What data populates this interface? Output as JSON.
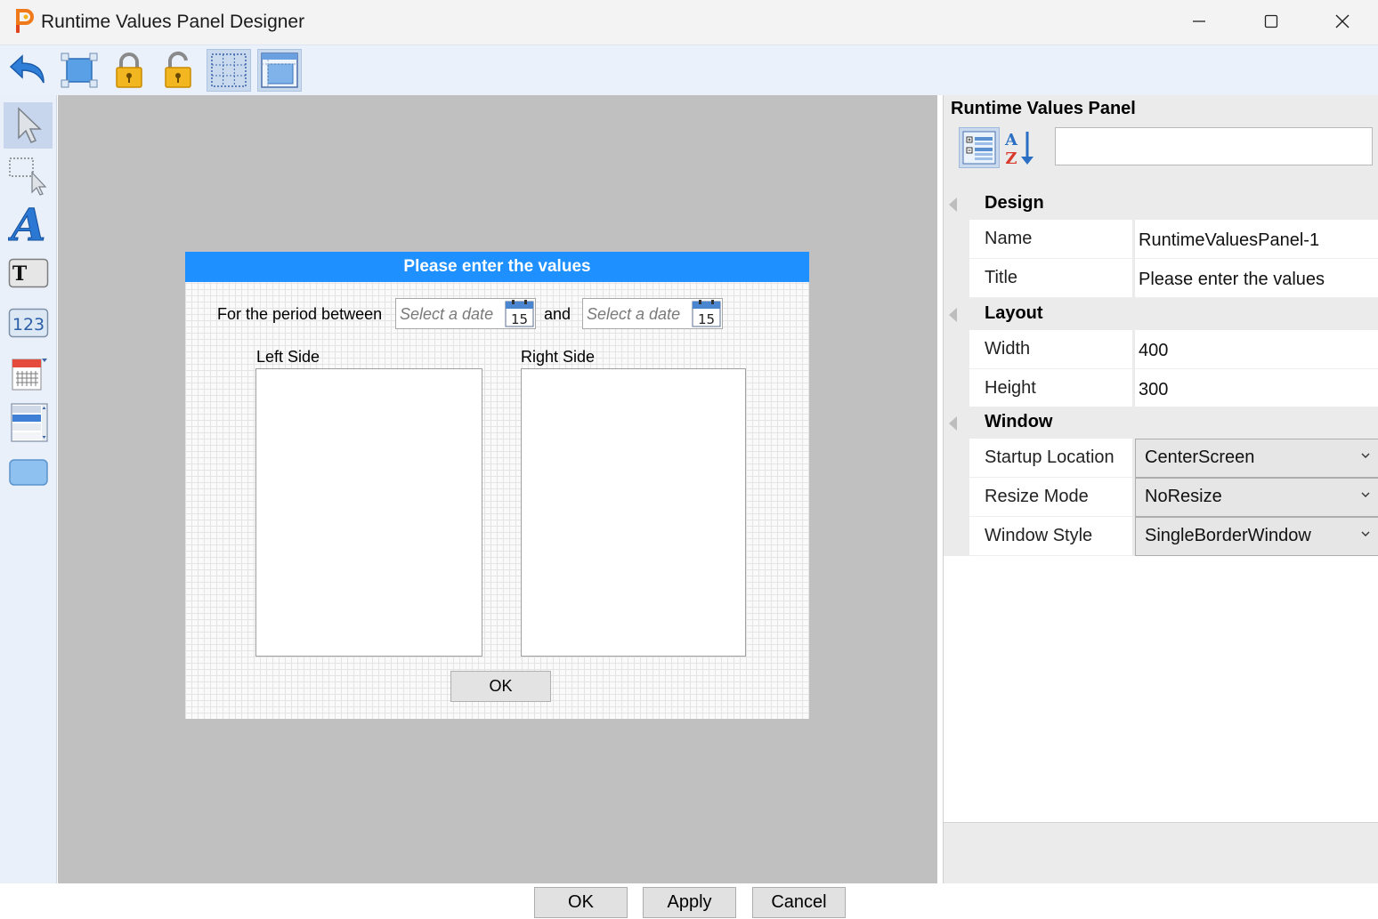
{
  "window": {
    "title": "Runtime Values Panel Designer",
    "icons": {
      "logo": "app-logo-icon",
      "minimize": "minimize-icon",
      "maximize": "maximize-icon",
      "close": "close-icon"
    }
  },
  "toolbar": {
    "items": [
      {
        "name": "undo-button",
        "icon": "undo-arrow-icon"
      },
      {
        "name": "select-all-button",
        "icon": "selection-frame-icon"
      },
      {
        "name": "lock-button",
        "icon": "lock-icon"
      },
      {
        "name": "unlock-button",
        "icon": "unlock-icon"
      },
      {
        "name": "show-grid-button",
        "icon": "grid-icon",
        "active": true
      },
      {
        "name": "snap-to-grid-button",
        "icon": "panel-grid-icon",
        "active": true
      }
    ]
  },
  "toolbox": {
    "items": [
      {
        "name": "pointer-tool",
        "icon": "cursor-arrow-icon",
        "active": true
      },
      {
        "name": "marquee-select-tool",
        "icon": "marquee-select-icon"
      },
      {
        "name": "label-tool",
        "icon": "label-a-icon"
      },
      {
        "name": "textbox-tool",
        "icon": "textbox-t-icon"
      },
      {
        "name": "numeric-tool",
        "icon": "numeric-123-icon",
        "text": "123"
      },
      {
        "name": "datepicker-tool",
        "icon": "calendar-icon"
      },
      {
        "name": "listbox-tool",
        "icon": "listbox-icon"
      },
      {
        "name": "button-tool",
        "icon": "button-shape-icon"
      }
    ]
  },
  "panel": {
    "header": "Please enter the values",
    "period_label": "For the period between",
    "and_label": "and",
    "date_placeholder": "Select a date",
    "calendar_day": "15",
    "left_side_label": "Left Side",
    "right_side_label": "Right Side",
    "ok_label": "OK"
  },
  "properties": {
    "title": "Runtime Values Panel",
    "categorized_icon": "categorized-view-icon",
    "alphabetical_icon": "sort-az-icon",
    "search_value": "",
    "categories": {
      "design": "Design",
      "layout": "Layout",
      "window": "Window"
    },
    "rows": {
      "name": {
        "label": "Name",
        "value": "RuntimeValuesPanel-1"
      },
      "title": {
        "label": "Title",
        "value": "Please enter the values"
      },
      "width": {
        "label": "Width",
        "value": "400"
      },
      "height": {
        "label": "Height",
        "value": "300"
      },
      "startup_location": {
        "label": "Startup Location",
        "value": "CenterScreen"
      },
      "resize_mode": {
        "label": "Resize Mode",
        "value": "NoResize"
      },
      "window_style": {
        "label": "Window Style",
        "value": "SingleBorderWindow"
      }
    }
  },
  "dialog_buttons": {
    "ok": "OK",
    "apply": "Apply",
    "cancel": "Cancel"
  },
  "colors": {
    "panel_header": "#1e90ff",
    "canvas": "#c0c0c0",
    "toolbar": "#eaf1fb"
  }
}
